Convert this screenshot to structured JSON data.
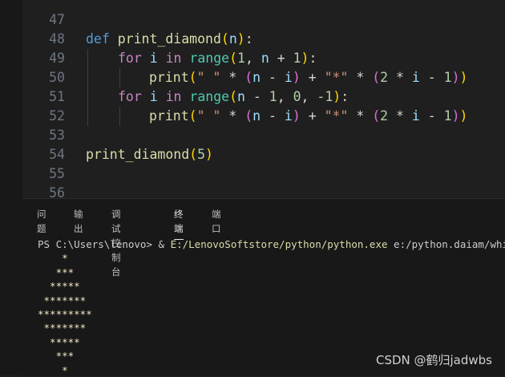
{
  "editor": {
    "line_numbers": [
      "47",
      "48",
      "49",
      "50",
      "51",
      "52",
      "53",
      "54",
      "55",
      "56"
    ],
    "code": {
      "l48": {
        "def": "def",
        "fn": "print_diamond",
        "open": "(",
        "param": "n",
        "close": ")",
        "colon": ":"
      },
      "l49": {
        "for": "for",
        "var": "i",
        "in": "in",
        "range": "range",
        "open": "(",
        "num1": "1",
        "comma": ", ",
        "n": "n",
        "plus": " + ",
        "num2": "1",
        "close": ")",
        "colon": ":"
      },
      "l50": {
        "print": "print",
        "open": "(",
        "s1": "\" \"",
        "mul1": " * ",
        "po": "(",
        "n": "n",
        "minus": " - ",
        "i": "i",
        "pc": ")",
        "plus": " + ",
        "s2": "\"*\"",
        "mul2": " * ",
        "po2": "(",
        "two": "2",
        "mul3": " * ",
        "i2": "i",
        "minus2": " - ",
        "one": "1",
        "pc2": ")",
        "close": ")"
      },
      "l51": {
        "for": "for",
        "var": "i",
        "in": "in",
        "range": "range",
        "open": "(",
        "n": "n",
        "minus": " - ",
        "num1": "1",
        "comma1": ", ",
        "num2": "0",
        "comma2": ", ",
        "num3": "-1",
        "close": ")",
        "colon": ":"
      },
      "l54": {
        "fn": "print_diamond",
        "open": "(",
        "num": "5",
        "close": ")"
      }
    }
  },
  "panel": {
    "tabs": [
      "问题",
      "输出",
      "调试控制台",
      "终端",
      "端口"
    ],
    "active_tab": "终端"
  },
  "terminal": {
    "prompt": "PS C:\\Users\\lenovo> & ",
    "exe_path": "E:/LenovoSoftstore/python/python.exe",
    "script_path": " e:/python.daiam/while循环",
    "output": [
      "    *",
      "   ***",
      "  *****",
      " *******",
      "*********",
      " *******",
      "  *****",
      "   ***",
      "    *"
    ]
  },
  "watermark": "CSDN @鹤归jadwbs"
}
